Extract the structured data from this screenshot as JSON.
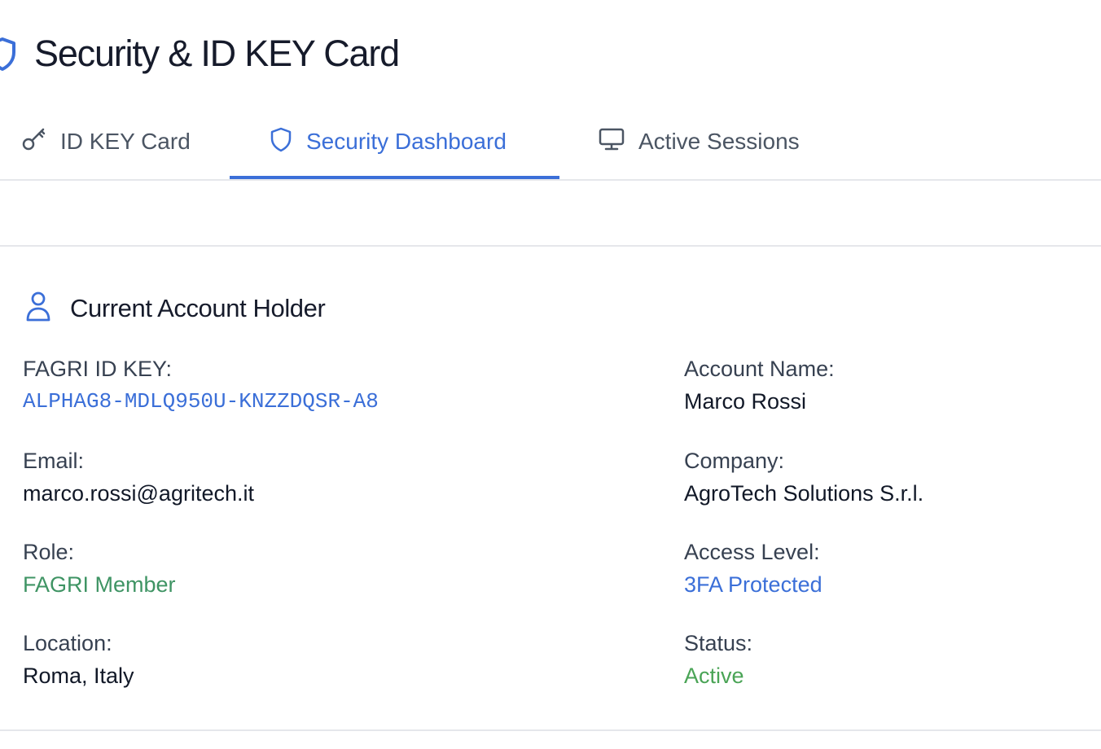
{
  "header": {
    "title": "Security & ID KEY Card"
  },
  "tabs": [
    {
      "label": "ID KEY Card",
      "icon": "key-icon",
      "active": false
    },
    {
      "label": "Security Dashboard",
      "icon": "shield-icon",
      "active": true
    },
    {
      "label": "Active Sessions",
      "icon": "monitor-icon",
      "active": false
    }
  ],
  "section": {
    "title": "Current Account Holder",
    "icon": "user-icon"
  },
  "fields": {
    "id_key": {
      "label": "FAGRI ID KEY:",
      "value": "ALPHAG8-MDLQ950U-KNZZDQSR-A8"
    },
    "account_name": {
      "label": "Account Name:",
      "value": "Marco Rossi"
    },
    "email": {
      "label": "Email:",
      "value": "marco.rossi@agritech.it"
    },
    "company": {
      "label": "Company:",
      "value": "AgroTech Solutions S.r.l."
    },
    "role": {
      "label": "Role:",
      "value": "FAGRI Member"
    },
    "access_level": {
      "label": "Access Level:",
      "value": "3FA Protected"
    },
    "location": {
      "label": "Location:",
      "value": "Roma, Italy"
    },
    "status": {
      "label": "Status:",
      "value": "Active"
    }
  },
  "colors": {
    "accent": "#3b6fd8",
    "role_green": "#3f9464",
    "status_green": "#4aa456",
    "divider": "#e5e7eb"
  }
}
